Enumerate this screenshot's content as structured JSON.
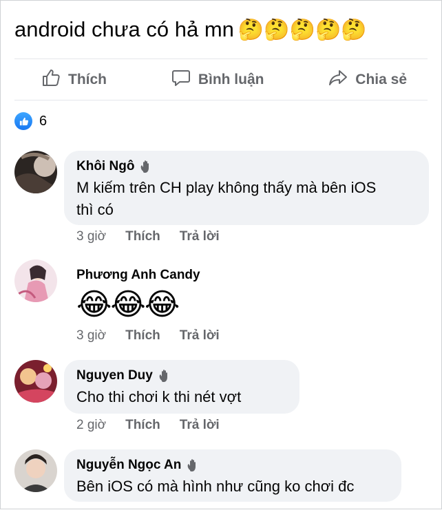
{
  "post": {
    "text": "android chưa có hả mn",
    "emojis": "🤔🤔🤔🤔🤔"
  },
  "actions": {
    "like_label": "Thích",
    "comment_label": "Bình luận",
    "share_label": "Chia sẻ"
  },
  "reactions": {
    "count": "6",
    "icon": "like-icon",
    "color": "#1877f2"
  },
  "comments": [
    {
      "author": "Khôi Ngô",
      "badge": "wave-icon",
      "text_line1": "M kiếm trên CH play không thấy mà bên iOS",
      "text_line2": "thì có",
      "time": "3 giờ",
      "like": "Thích",
      "reply": "Trả lời"
    },
    {
      "author": "Phương Anh Candy",
      "text": "😂😂😂",
      "time": "3 giờ",
      "like": "Thích",
      "reply": "Trả lời"
    },
    {
      "author": "Nguyen Duy",
      "badge": "wave-icon",
      "text": "Cho thi chơi  k thi nét  vợt",
      "time": "2 giờ",
      "like": "Thích",
      "reply": "Trả lời"
    },
    {
      "author": "Nguyễn Ngọc An",
      "badge": "wave-icon",
      "text": "Bên iOS có mà hình như cũng ko chơi đc"
    }
  ]
}
